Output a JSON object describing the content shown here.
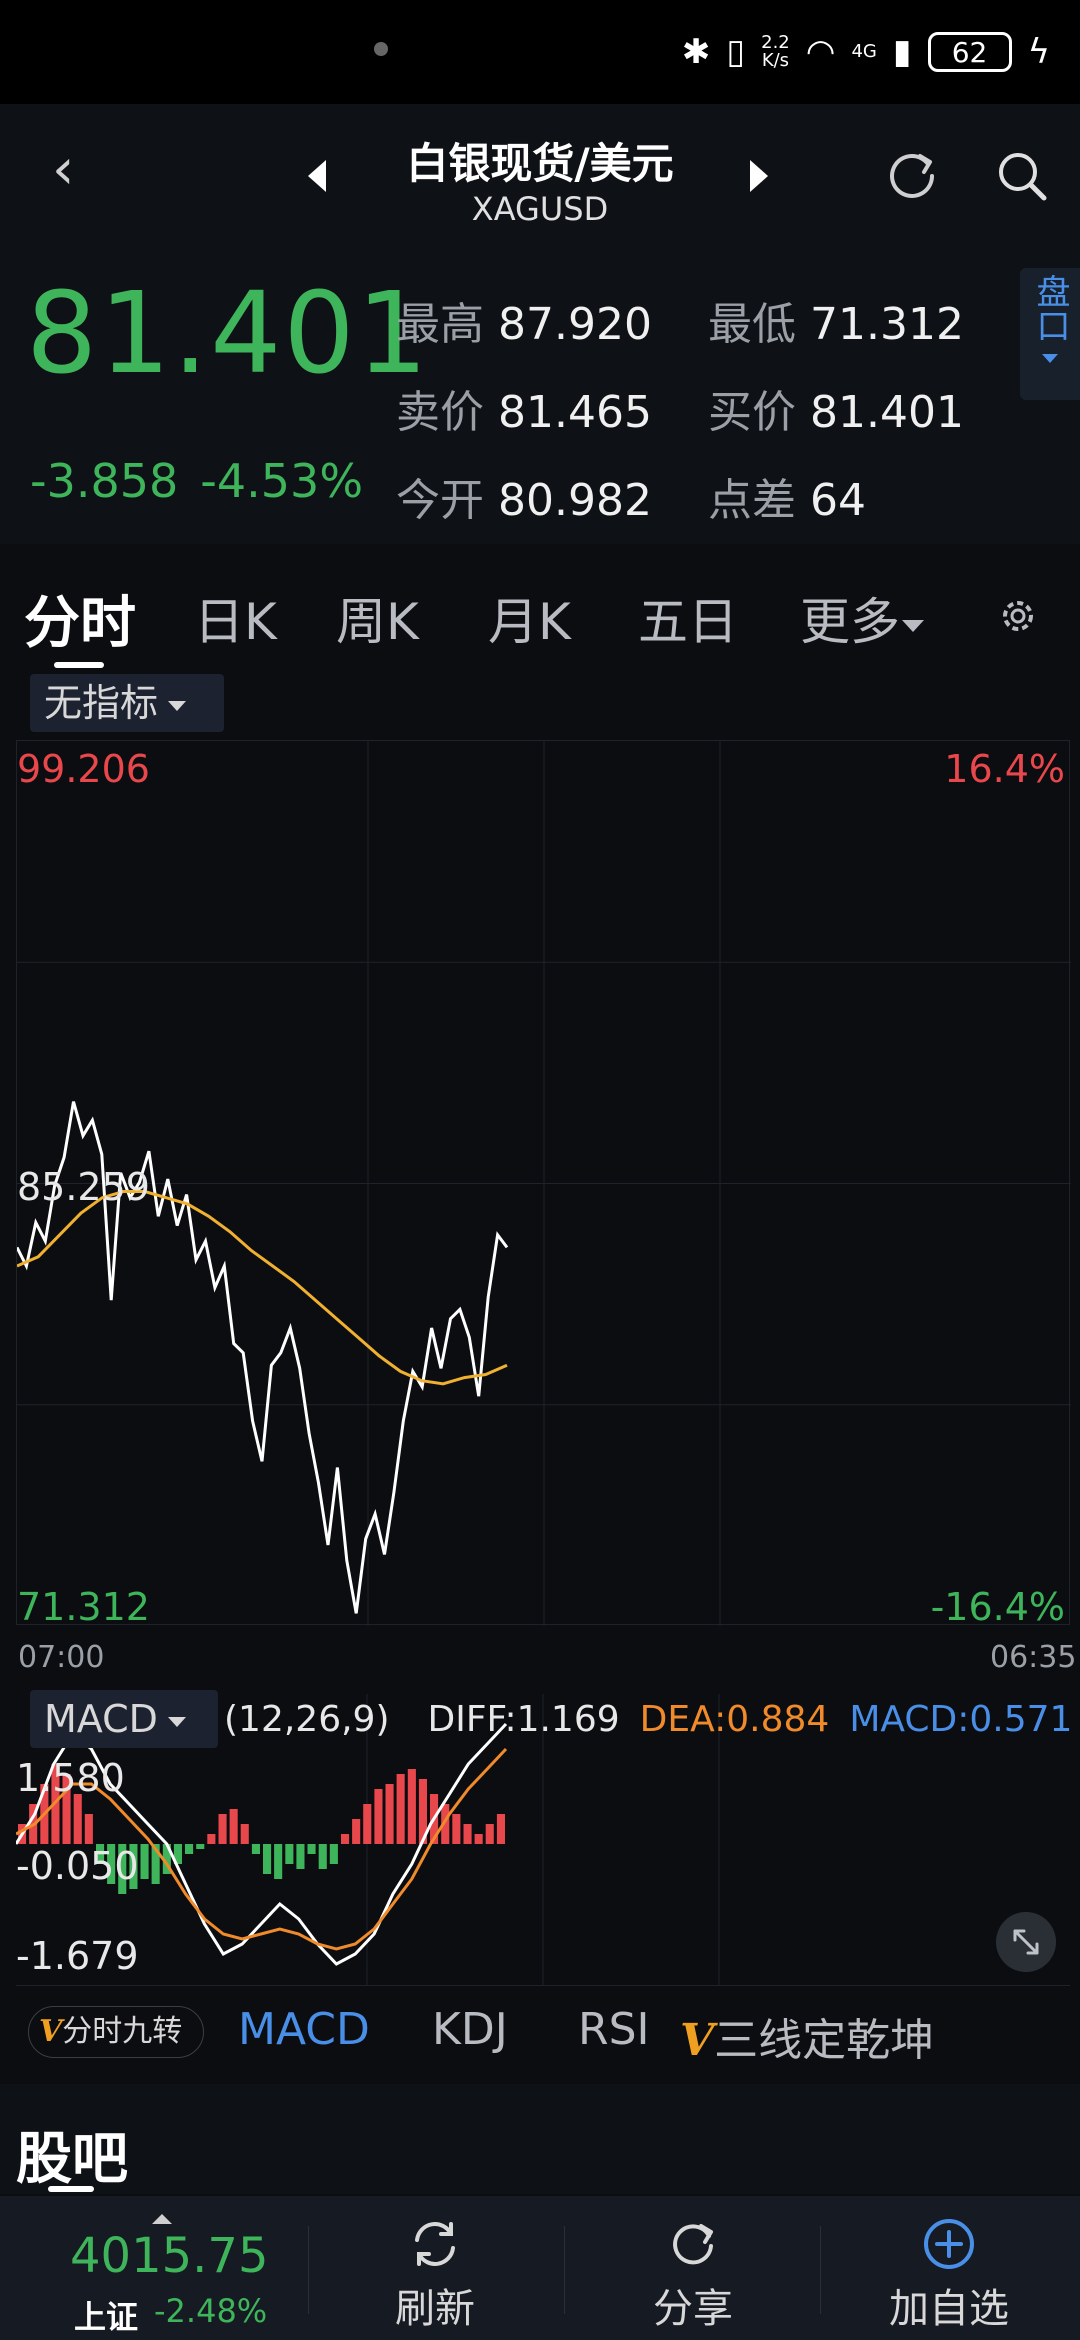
{
  "status_bar": {
    "speed_top": "2.2",
    "speed_bottom": "K/s",
    "network": "4G",
    "battery": "62"
  },
  "header": {
    "title": "白银现货/美元",
    "symbol": "XAGUSD"
  },
  "quote": {
    "price": "81.401",
    "change": "-3.858",
    "change_pct": "-4.53%",
    "high_label": "最高",
    "high": "87.920",
    "low_label": "最低",
    "low": "71.312",
    "ask_label": "卖价",
    "ask": "81.465",
    "bid_label": "买价",
    "bid": "81.401",
    "open_label": "今开",
    "open": "80.982",
    "spread_label": "点差",
    "spread": "64",
    "pankou": "盘口"
  },
  "tabs": [
    "分时",
    "日K",
    "周K",
    "月K",
    "五日",
    "更多"
  ],
  "indicator": "无指标",
  "chart": {
    "y_top": "99.206",
    "y_mid": "85.259",
    "y_bottom": "71.312",
    "pct_top": "16.4%",
    "pct_bottom": "-16.4%",
    "time_start": "07:00",
    "time_end": "06:35"
  },
  "chart_data": {
    "type": "line",
    "ylim": [
      71.312,
      99.206
    ],
    "series": [
      {
        "values": [
          83.2,
          82.6,
          84.0,
          83.4,
          85.2,
          86.1,
          87.9,
          86.8,
          87.3,
          86.2,
          81.5,
          85.6,
          84.8,
          85.3,
          86.3,
          84.2,
          85.4,
          83.9,
          84.9,
          82.8,
          83.4,
          81.9,
          82.6,
          80.1,
          79.8,
          77.6,
          76.3,
          79.4,
          79.8,
          80.6,
          79.3,
          77.2,
          75.6,
          73.6,
          76.1,
          73.1,
          71.4,
          73.8,
          74.6,
          73.3,
          75.3,
          77.6,
          79.2,
          78.7,
          80.6,
          79.3,
          80.9,
          81.2,
          80.3,
          78.4,
          81.6,
          83.6,
          83.2
        ]
      },
      {
        "values": [
          82.6,
          82.9,
          83.6,
          84.3,
          84.8,
          85.0,
          85.0,
          84.8,
          84.6,
          84.2,
          83.7,
          83.1,
          82.6,
          82.1,
          81.5,
          80.9,
          80.3,
          79.7,
          79.2,
          78.9,
          78.8,
          79.0,
          79.1,
          79.4
        ]
      }
    ]
  },
  "macd": {
    "label": "MACD",
    "params": "(12,26,9)",
    "diff": "DIFF:1.169",
    "dea": "DEA:0.884",
    "macd": "MACD:0.571",
    "axis_top": "1.580",
    "axis_mid": "-0.050",
    "axis_bottom": "-1.679"
  },
  "indicator_tabs": {
    "pill": "分时九转",
    "v": "V",
    "macd": "MACD",
    "kdj": "KDJ",
    "rsi": "RSI",
    "sanxian": "三线定乾坤"
  },
  "guba": "股吧",
  "bottom": {
    "index_value": "4015.75",
    "index_name": "上证",
    "index_change": "-2.48%",
    "refresh": "刷新",
    "share": "分享",
    "add": "加自选"
  },
  "colors": {
    "up": "#e8474c",
    "down": "#3fb55b",
    "accent": "#4a8fe7",
    "avg_line": "#f0b030",
    "dea": "#f08a2a"
  }
}
